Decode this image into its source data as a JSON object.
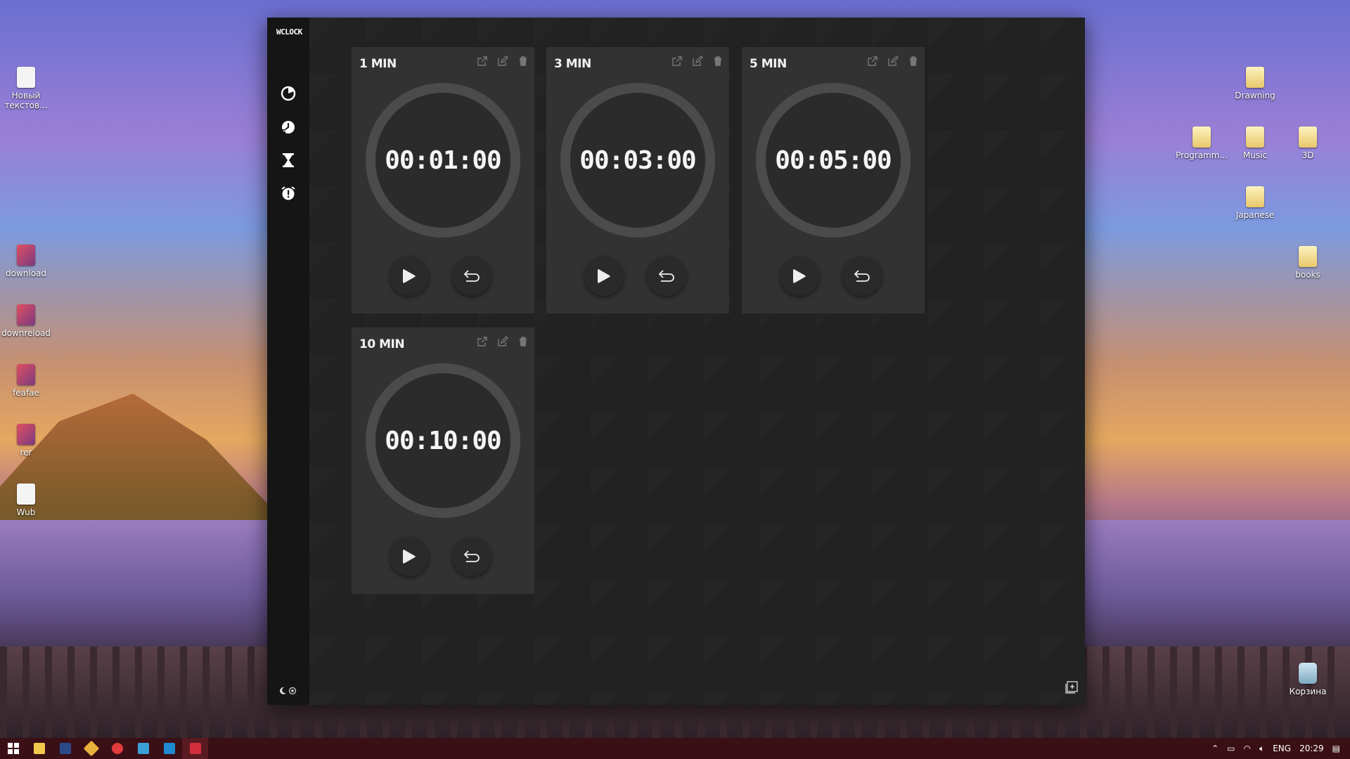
{
  "app": {
    "brand": "WCLOCK"
  },
  "nav": {
    "items": [
      {
        "name": "clock",
        "icon": "clock-icon"
      },
      {
        "name": "world-clock",
        "icon": "history-icon"
      },
      {
        "name": "timer",
        "icon": "hourglass-icon"
      },
      {
        "name": "alarm",
        "icon": "alarm-icon"
      }
    ]
  },
  "timers": [
    {
      "title": "1 MIN",
      "time": "00:01:00"
    },
    {
      "title": "3 MIN",
      "time": "00:03:00"
    },
    {
      "title": "5 MIN",
      "time": "00:05:00"
    },
    {
      "title": "10 MIN",
      "time": "00:10:00"
    }
  ],
  "desktop": {
    "left": [
      "Новый текстов...",
      "download",
      "downreload",
      "feafae",
      "rer",
      "Wub"
    ],
    "right": [
      "Drawning",
      "Programm...",
      "Music",
      "3D",
      "Japanese",
      "books",
      "Корзина"
    ]
  },
  "tray": {
    "lang": "ENG",
    "time": "20:29"
  },
  "colors": {
    "card": "#323232",
    "ring": "#4b4b4b",
    "taskbar": "#3b0f16"
  }
}
